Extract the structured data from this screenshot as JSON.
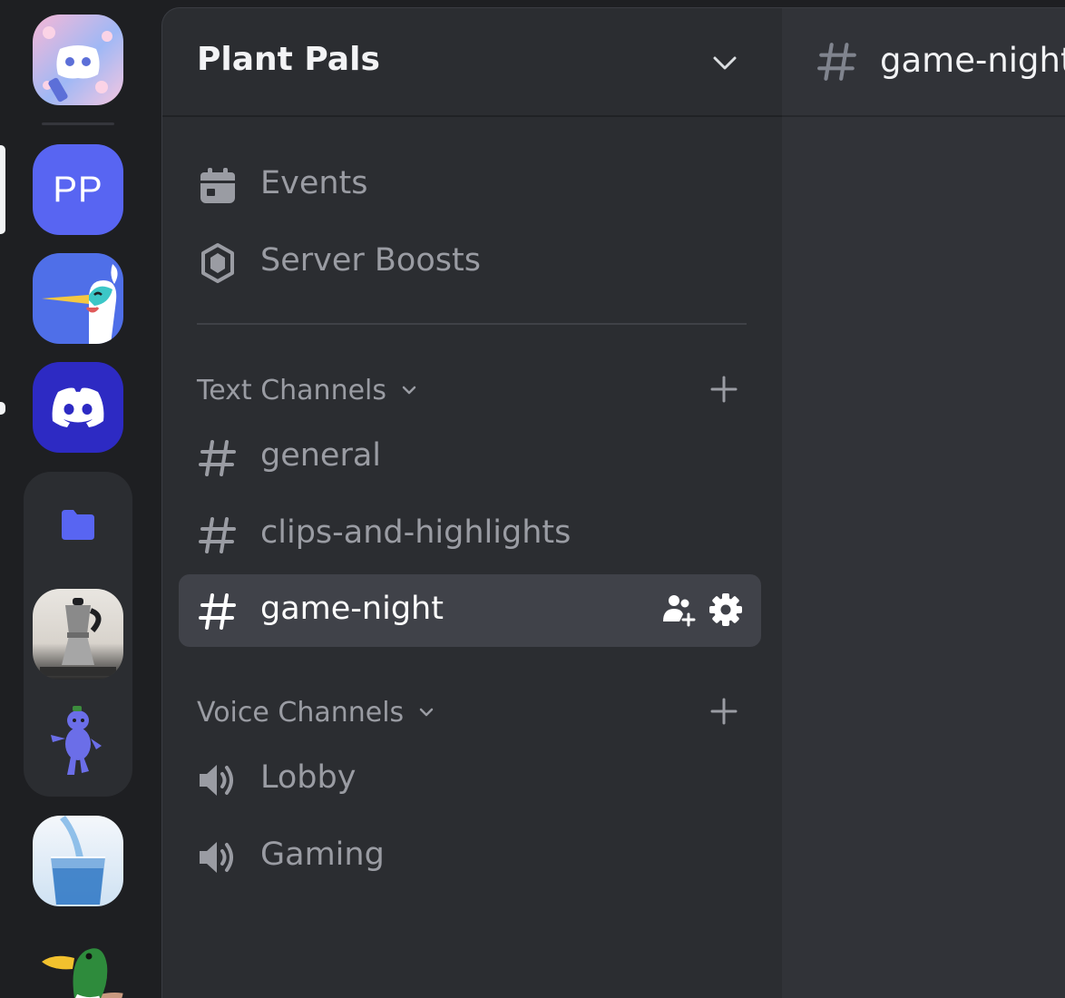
{
  "server_rail": {
    "items": [
      {
        "name": "Direct Messages",
        "kind": "discord-logo-sakura"
      },
      {
        "initials": "PP",
        "color": "#5865f2"
      },
      {
        "name": "bird server",
        "kind": "bird-avatar"
      },
      {
        "name": "Discord",
        "kind": "discord-logo",
        "color": "#2d2ac3"
      },
      {
        "name": "folder",
        "kind": "folder-icon",
        "color": "#5865f2"
      },
      {
        "name": "moka pot server",
        "kind": "moka-pot-image"
      },
      {
        "name": "wumpus server",
        "kind": "wumpus-figure"
      },
      {
        "name": "water glass server",
        "kind": "water-glass-image"
      },
      {
        "name": "duck server",
        "kind": "duck-image"
      }
    ]
  },
  "sidebar": {
    "server_name": "Plant Pals",
    "menu": [
      {
        "label": "Events",
        "icon": "calendar-icon"
      },
      {
        "label": "Server Boosts",
        "icon": "boost-gem-icon"
      }
    ],
    "categories": [
      {
        "label": "Text Channels",
        "channels": [
          {
            "label": "general",
            "icon": "hash-icon"
          },
          {
            "label": "clips-and-highlights",
            "icon": "hash-icon"
          },
          {
            "label": "game-night",
            "icon": "hash-icon",
            "selected": true
          }
        ]
      },
      {
        "label": "Voice Channels",
        "channels": [
          {
            "label": "Lobby",
            "icon": "speaker-icon"
          },
          {
            "label": "Gaming",
            "icon": "speaker-icon"
          }
        ]
      }
    ]
  },
  "main": {
    "channel_title": "game-night"
  },
  "colors": {
    "rail_bg": "#1e1f22",
    "sidebar_bg": "#2b2d31",
    "main_bg": "#313338",
    "selected_row": "#404249",
    "blurple": "#5865f2",
    "muted_text": "#9a9ca3"
  }
}
